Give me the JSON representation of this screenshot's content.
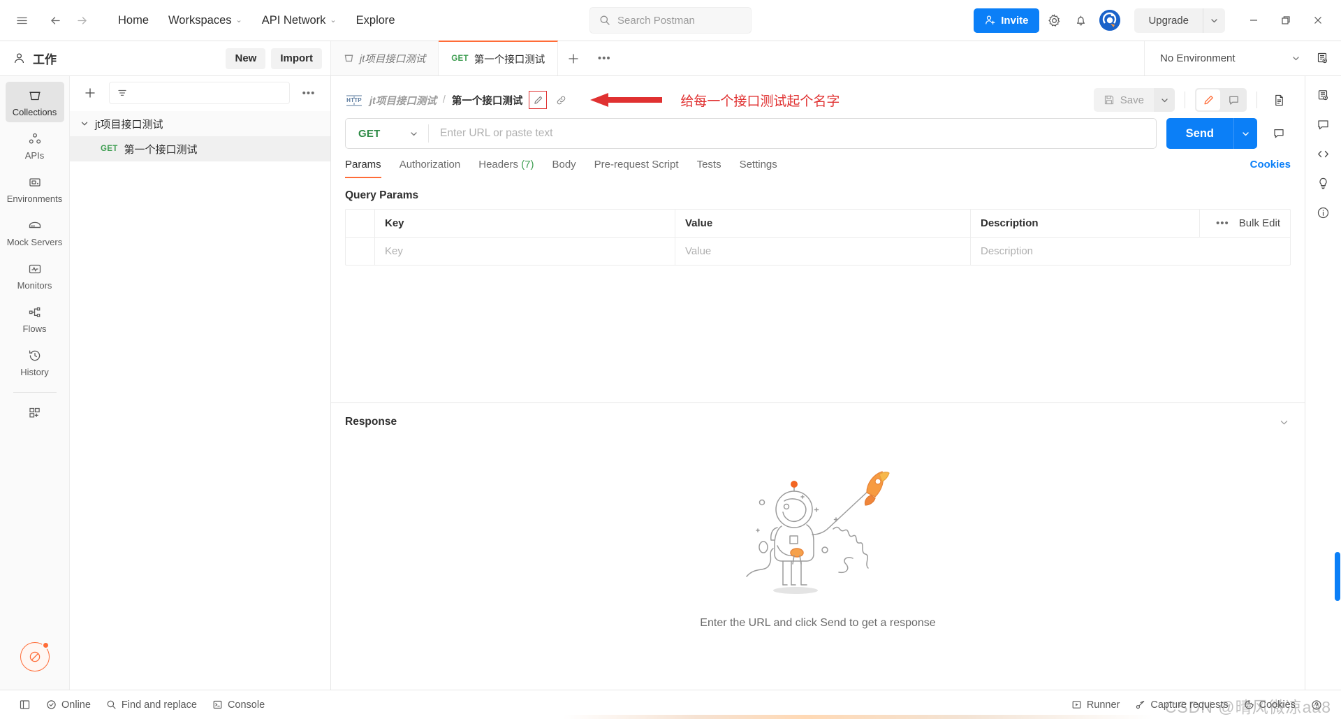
{
  "topbar": {
    "hamburger_icon": "hamburger-icon",
    "back_icon": "arrow-left-icon",
    "forward_icon": "arrow-right-icon",
    "links": [
      {
        "label": "Home",
        "has_caret": false
      },
      {
        "label": "Workspaces",
        "has_caret": true
      },
      {
        "label": "API Network",
        "has_caret": true
      },
      {
        "label": "Explore",
        "has_caret": false
      }
    ],
    "search": {
      "placeholder": "Search Postman",
      "value": "",
      "icon": "search-icon"
    },
    "invite_label": "Invite",
    "settings_icon": "gear-icon",
    "notifications_icon": "bell-icon",
    "avatar_icon": "user-avatar",
    "upgrade_label": "Upgrade",
    "window": {
      "minimize": "minimize-icon",
      "maximize": "maximize-icon",
      "close": "close-icon"
    }
  },
  "workspace": {
    "name": "工作",
    "new_label": "New",
    "import_label": "Import"
  },
  "tabs": [
    {
      "label": "jt项目接口测试",
      "method": "",
      "active": false,
      "icon": "collection-icon"
    },
    {
      "label": "第一个接口测试",
      "method": "GET",
      "active": true,
      "icon": ""
    }
  ],
  "tab_add_icon": "plus-icon",
  "tab_more_icon": "more-horizontal-icon",
  "environment": {
    "selected": "No Environment",
    "eye_icon": "environment-quicklook-icon"
  },
  "rail": {
    "items": [
      {
        "label": "Collections",
        "icon": "collections-icon",
        "active": true
      },
      {
        "label": "APIs",
        "icon": "apis-icon",
        "active": false
      },
      {
        "label": "Environments",
        "icon": "environments-icon",
        "active": false
      },
      {
        "label": "Mock Servers",
        "icon": "mock-servers-icon",
        "active": false
      },
      {
        "label": "Monitors",
        "icon": "monitors-icon",
        "active": false
      },
      {
        "label": "Flows",
        "icon": "flows-icon",
        "active": false
      },
      {
        "label": "History",
        "icon": "history-icon",
        "active": false
      }
    ],
    "add_icon": "add-panel-icon",
    "bottom_icon": "trial-badge-icon"
  },
  "sidebar": {
    "add_icon": "plus-icon",
    "filter_icon": "filter-icon",
    "more_icon": "more-horizontal-icon",
    "filter_placeholder": "",
    "tree": [
      {
        "label": "jt项目接口测试",
        "type": "collection",
        "expanded": true,
        "method": ""
      },
      {
        "label": "第一个接口测试",
        "type": "request",
        "method": "GET",
        "selected": true
      }
    ]
  },
  "breadcrumb": {
    "protocol_badge": "HTTP",
    "parent": "jt项目接口测试",
    "separator": "/",
    "current": "第一个接口测试",
    "edit_icon": "pencil-icon",
    "link_icon": "link-icon"
  },
  "annotation": {
    "text": "给每一个接口测试起个名字",
    "color": "#e03131",
    "arrow_icon": "arrow-left-annotation"
  },
  "request_actions": {
    "save_label": "Save",
    "save_icon": "save-icon",
    "save_caret_icon": "chevron-down-icon",
    "edit_toggle_icon": "pencil-icon",
    "comment_toggle_icon": "comment-icon",
    "documentation_icon": "document-icon"
  },
  "request": {
    "method": "GET",
    "method_caret": "chevron-down-icon",
    "url_value": "",
    "url_placeholder": "Enter URL or paste text",
    "send_label": "Send",
    "send_caret_icon": "chevron-down-icon",
    "comment_icon": "comment-icon"
  },
  "request_tabs": [
    {
      "label": "Params",
      "count": "",
      "active": true
    },
    {
      "label": "Authorization",
      "count": "",
      "active": false
    },
    {
      "label": "Headers",
      "count": "(7)",
      "active": false
    },
    {
      "label": "Body",
      "count": "",
      "active": false
    },
    {
      "label": "Pre-request Script",
      "count": "",
      "active": false
    },
    {
      "label": "Tests",
      "count": "",
      "active": false
    },
    {
      "label": "Settings",
      "count": "",
      "active": false
    }
  ],
  "cookies_link": "Cookies",
  "query_params": {
    "title": "Query Params",
    "columns": [
      "Key",
      "Value",
      "Description"
    ],
    "rows": [
      {
        "key": "Key",
        "value": "Value",
        "description": "Description"
      }
    ],
    "more_icon": "more-horizontal-icon",
    "bulk_edit_label": "Bulk Edit"
  },
  "response": {
    "title": "Response",
    "collapse_icon": "chevron-down-icon",
    "empty_text": "Enter the URL and click Send to get a response",
    "illustration": "astronaut-rocket-kite"
  },
  "right_rail": [
    {
      "icon": "environment-panel-icon"
    },
    {
      "icon": "comments-panel-icon"
    },
    {
      "icon": "code-snippet-icon"
    },
    {
      "icon": "lightbulb-icon"
    },
    {
      "icon": "info-circle-icon"
    }
  ],
  "statusbar": {
    "left": [
      {
        "label": "",
        "icon": "sidebar-toggle-icon"
      },
      {
        "label": "Online",
        "icon": "check-circle-icon"
      },
      {
        "label": "Find and replace",
        "icon": "search-icon"
      },
      {
        "label": "Console",
        "icon": "terminal-icon"
      }
    ],
    "right": [
      {
        "label": "Runner",
        "icon": "runner-icon"
      },
      {
        "label": "Capture requests",
        "icon": "capture-icon"
      },
      {
        "label": "Cookies",
        "icon": "cookie-icon"
      },
      {
        "label": "",
        "icon": "help-circle-icon"
      }
    ]
  },
  "watermark": "CSDN @晴风微凉aa8"
}
